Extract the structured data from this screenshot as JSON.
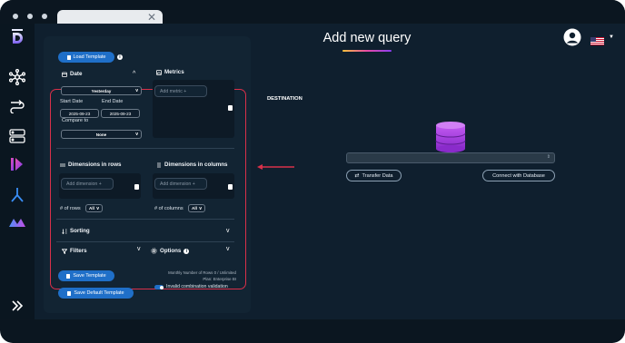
{
  "browser": {
    "tab_close": "✕"
  },
  "panel": {
    "load_template": "Load Template",
    "date": {
      "title": "Date",
      "period": "Yesterday",
      "start_label": "Start Date",
      "end_label": "End Date",
      "start_value": "2025-09-23",
      "end_value": "2025-09-23",
      "compare_label": "Compare to",
      "compare_value": "None"
    },
    "metrics": {
      "title": "Metrics",
      "placeholder": "Add metric +"
    },
    "dimensions_rows": {
      "title": "Dimensions in rows",
      "placeholder": "Add dimension +",
      "count_label": "# of rows",
      "count_value": "All"
    },
    "dimensions_columns": {
      "title": "Dimensions in columns",
      "placeholder": "Add dimension +",
      "count_label": "# of columns",
      "count_value": "All"
    },
    "sorting": "Sorting",
    "filters": "Filters",
    "options": "Options",
    "save_template": "Save Template",
    "save_default_template": "Save Default Template",
    "plan_line1": "Monthly Number of Rows 0 / Unlimited",
    "plan_line2": "Plan: Enterprise BI",
    "invalid_combination": "Invalid combination validation"
  },
  "main": {
    "title": "Add new query",
    "destination_label": "DESTINATION",
    "transfer_data": "Transfer Data",
    "connect_database": "Connect with Database"
  },
  "colors": {
    "accent": "#1f6fc8",
    "highlight": "#d9304a",
    "database": "#a23bd8"
  },
  "icons": [
    "logo-icon",
    "network-icon",
    "transfer-icon",
    "server-icon",
    "bar-logo-icon",
    "merge-icon",
    "wave-logo-icon",
    "expand-icon",
    "user-icon",
    "flag-us-icon"
  ]
}
